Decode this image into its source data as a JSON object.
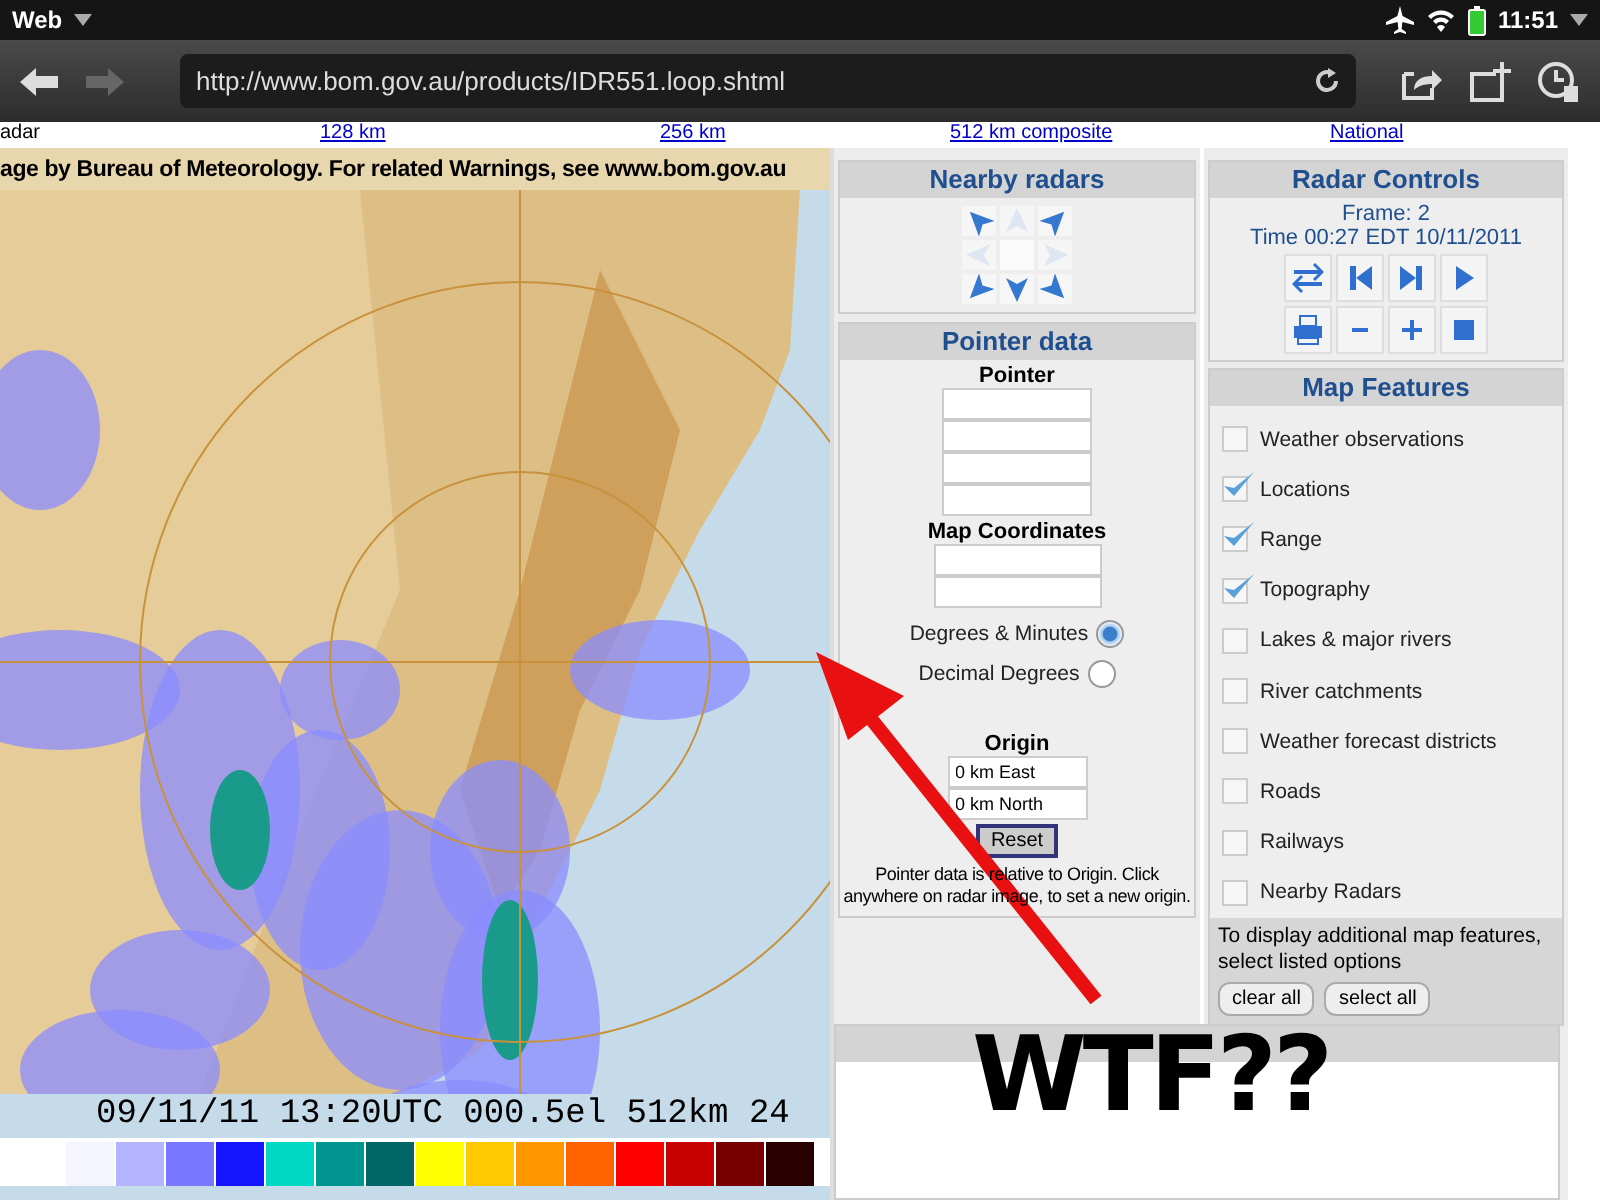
{
  "status_bar": {
    "app": "Web",
    "time": "11:51"
  },
  "toolbar": {
    "url": "http://www.bom.gov.au/products/IDR551.loop.shtml",
    "forward_disabled": true
  },
  "links": [
    {
      "label": "adar",
      "kind": "text"
    },
    {
      "label": "128 km",
      "kind": "link"
    },
    {
      "label": "256 km",
      "kind": "link"
    },
    {
      "label": "512 km composite",
      "kind": "link"
    },
    {
      "label": "National",
      "kind": "link"
    }
  ],
  "map": {
    "header": "age by Bureau of Meteorology. For related Warnings, see www.bom.gov.au",
    "caption": "09/11/11 13:20UTC 000.5el 512km 24",
    "legend": [
      {
        "color": "#f5f5ff"
      },
      {
        "color": "#b4b4ff"
      },
      {
        "color": "#7878ff"
      },
      {
        "color": "#1414ff"
      },
      {
        "color": "#00d8c3"
      },
      {
        "color": "#009690"
      },
      {
        "color": "#006666"
      },
      {
        "color": "#ffff00"
      },
      {
        "color": "#ffc800"
      },
      {
        "color": "#ff9600"
      },
      {
        "color": "#ff6400"
      },
      {
        "color": "#ff0000"
      },
      {
        "color": "#c80000"
      },
      {
        "color": "#780000"
      },
      {
        "color": "#280000"
      }
    ]
  },
  "nearby_radars": {
    "title": "Nearby radars",
    "arrows": [
      {
        "kind": "nw",
        "disabled": false
      },
      {
        "kind": "n",
        "disabled": true
      },
      {
        "kind": "ne",
        "disabled": false
      },
      {
        "kind": "w",
        "disabled": true
      },
      {
        "kind": "e",
        "disabled": true
      },
      {
        "kind": "sw",
        "disabled": false
      },
      {
        "kind": "s",
        "disabled": false
      },
      {
        "kind": "se",
        "disabled": false
      }
    ]
  },
  "pointer_data": {
    "title": "Pointer data",
    "pointer_label": "Pointer",
    "map_coordinates_label": "Map Coordinates",
    "units": [
      {
        "label": "Degrees & Minutes",
        "selected": true
      },
      {
        "label": "Decimal Degrees",
        "selected": false
      }
    ],
    "origin_label": "Origin",
    "origin_fields": [
      "0 km East",
      "0 km North"
    ],
    "reset": "Reset",
    "note": "Pointer data is relative to Origin. Click anywhere on radar image, to set a new origin."
  },
  "radar_controls": {
    "title": "Radar Controls",
    "frame": "Frame: 2",
    "time": "Time 00:27 EDT 10/11/2011",
    "buttons": [
      {
        "kind": "swap"
      },
      {
        "kind": "first"
      },
      {
        "kind": "last"
      },
      {
        "kind": "play"
      },
      {
        "kind": "print"
      },
      {
        "kind": "minus"
      },
      {
        "kind": "plus"
      },
      {
        "kind": "stop"
      }
    ]
  },
  "map_features": {
    "title": "Map Features",
    "options": [
      {
        "label": "Weather observations",
        "checked": false
      },
      {
        "label": "Locations",
        "checked": true
      },
      {
        "label": "Range",
        "checked": true
      },
      {
        "label": "Topography",
        "checked": true
      },
      {
        "label": "Lakes & major rivers",
        "checked": false
      },
      {
        "label": "River catchments",
        "checked": false
      },
      {
        "label": "Weather forecast districts",
        "checked": false
      },
      {
        "label": "Roads",
        "checked": false
      },
      {
        "label": "Railways",
        "checked": false
      },
      {
        "label": "Nearby Radars",
        "checked": false
      }
    ],
    "hint": "To display additional map features, select listed options",
    "buttons": [
      "clear all",
      "select all"
    ]
  },
  "annotation": {
    "text": "WTF??"
  }
}
